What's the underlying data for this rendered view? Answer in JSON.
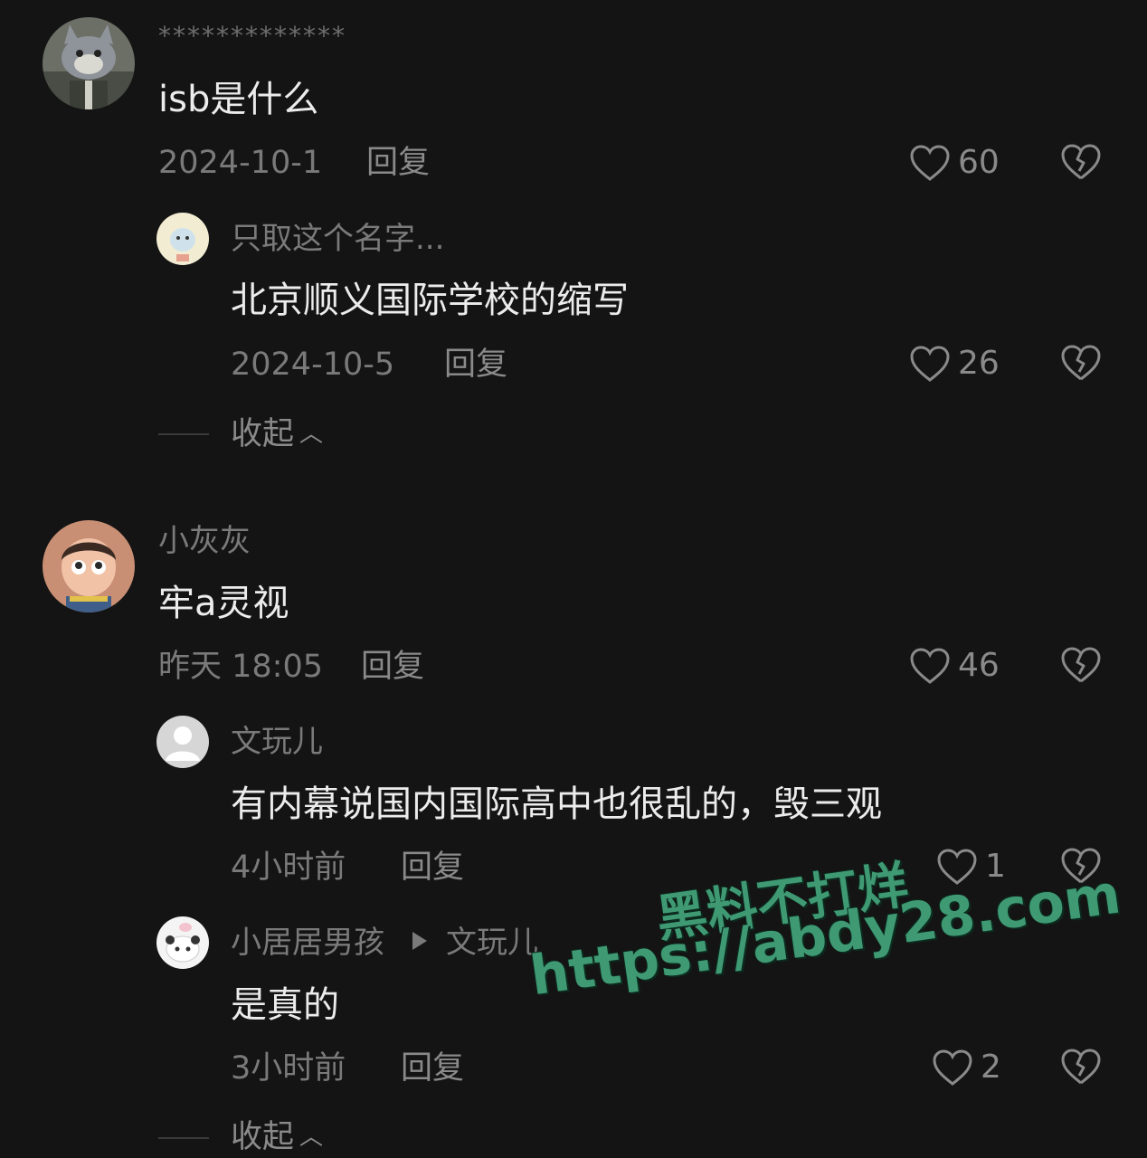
{
  "comments": [
    {
      "username": "*************",
      "text": "isb是什么",
      "date": "2024-10-1",
      "reply_label": "回复",
      "likes": "60",
      "avatar_icon": "cat-avatar"
    },
    {
      "username": "小灰灰",
      "text": "牢a灵视",
      "date": "昨天 18:05",
      "reply_label": "回复",
      "likes": "46",
      "avatar_icon": "girl-avatar"
    }
  ],
  "replies": [
    {
      "username": "只取这个名字...",
      "text": "北京顺义国际学校的缩写",
      "date": "2024-10-5",
      "reply_label": "回复",
      "likes": "26",
      "avatar_icon": "cartoon-animal-avatar"
    },
    {
      "username": "文玩儿",
      "text": "有内幕说国内国际高中也很乱的，毁三观",
      "date": "4小时前",
      "reply_label": "回复",
      "likes": "1",
      "avatar_icon": "default-user-avatar"
    },
    {
      "username": "小居居男孩",
      "reply_to": "文玩儿",
      "text": "是真的",
      "date": "3小时前",
      "reply_label": "回复",
      "likes": "2",
      "avatar_icon": "panda-avatar"
    }
  ],
  "collapse_label": "收起",
  "watermark": {
    "line1": "黑料不打烊",
    "line2": "https://abdy28.com"
  },
  "colors": {
    "background": "#141414",
    "text": "#ececec",
    "secondary": "#7a7a7a",
    "watermark": "#3f9a74"
  }
}
